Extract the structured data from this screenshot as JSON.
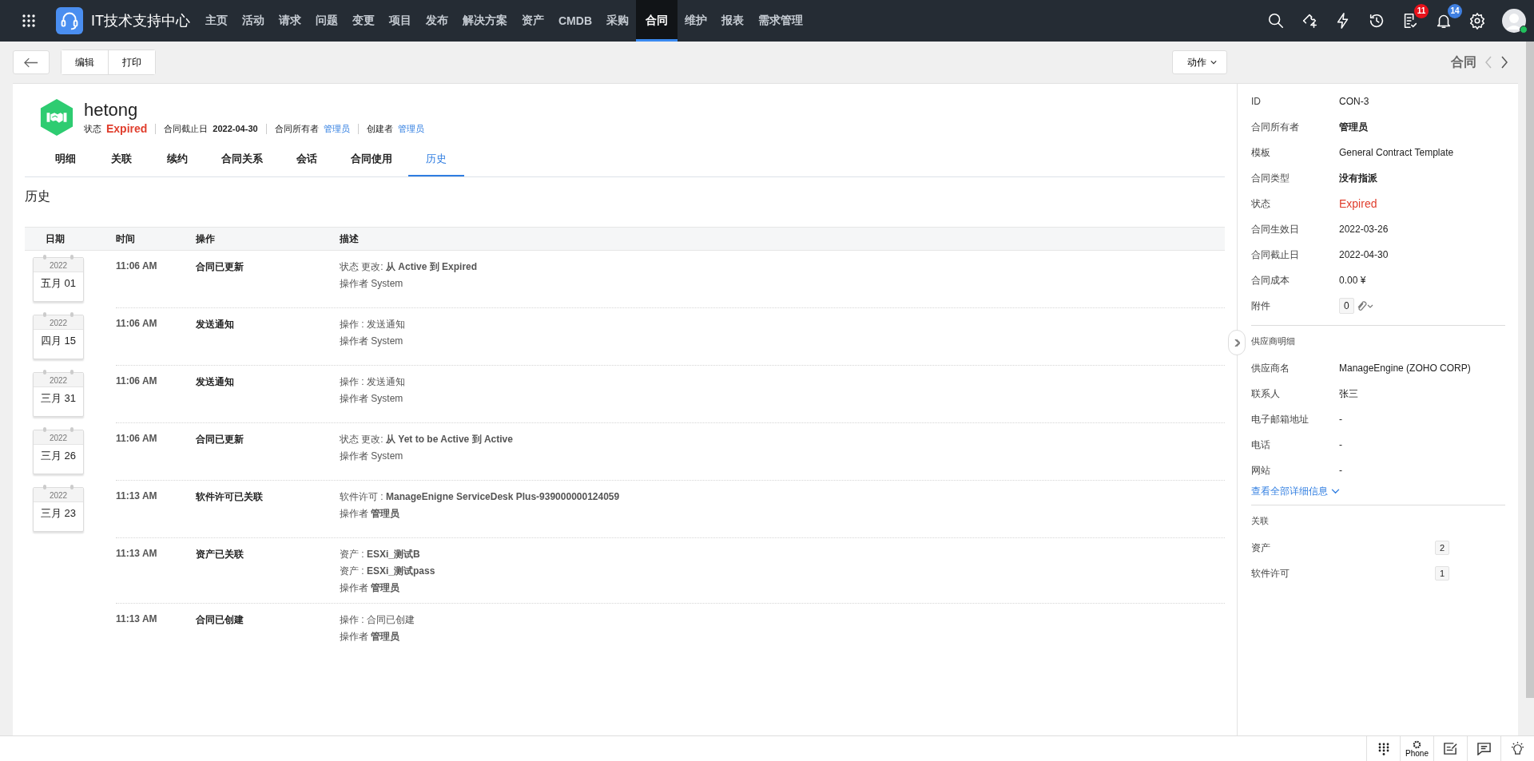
{
  "app": {
    "title": "IT技术支持中心"
  },
  "nav": [
    {
      "label": "主页",
      "selected": false
    },
    {
      "label": "活动",
      "selected": false
    },
    {
      "label": "请求",
      "selected": false
    },
    {
      "label": "问题",
      "selected": false
    },
    {
      "label": "变更",
      "selected": false
    },
    {
      "label": "项目",
      "selected": false
    },
    {
      "label": "发布",
      "selected": false
    },
    {
      "label": "解决方案",
      "selected": false
    },
    {
      "label": "资产",
      "selected": false
    },
    {
      "label": "CMDB",
      "selected": false
    },
    {
      "label": "采购",
      "selected": false
    },
    {
      "label": "合同",
      "selected": true
    },
    {
      "label": "维护",
      "selected": false
    },
    {
      "label": "报表",
      "selected": false
    },
    {
      "label": "需求管理",
      "selected": false
    }
  ],
  "top_icons": [
    {
      "kind": "search"
    },
    {
      "kind": "ticket"
    },
    {
      "kind": "bolt"
    },
    {
      "kind": "history"
    },
    {
      "kind": "tasks",
      "badge": "11",
      "color": "#e8121b"
    },
    {
      "kind": "bell",
      "badge": "14",
      "color": "#3f7fe0"
    },
    {
      "kind": "settings"
    },
    {
      "kind": "avatar"
    }
  ],
  "toolbar": {
    "buttons": [
      "编辑",
      "打印"
    ],
    "actions": "动作"
  },
  "record": {
    "name": "hetong",
    "meta": [
      {
        "label": "状态",
        "value": "Expired",
        "kind": "status"
      },
      {
        "label": "合同截止日",
        "value": "2022-04-30",
        "kind": "plain"
      },
      {
        "label": "合同所有者",
        "value": "管理员",
        "kind": "link"
      },
      {
        "label": "创建者",
        "value": "管理员",
        "kind": "link"
      }
    ]
  },
  "tabs": [
    {
      "label": "明细",
      "selected": false
    },
    {
      "label": "关联",
      "selected": false
    },
    {
      "label": "续约",
      "selected": false
    },
    {
      "label": "合同关系",
      "selected": false
    },
    {
      "label": "会话",
      "selected": false
    },
    {
      "label": "合同使用",
      "selected": false
    },
    {
      "label": "历史",
      "selected": true
    }
  ],
  "section_title": "历史",
  "history": {
    "columns": [
      "日期",
      "时间",
      "操作",
      "描述"
    ],
    "rows": [
      {
        "date": {
          "year": "2022",
          "day": "五月 01"
        },
        "time": "11:06 AM",
        "action": "合同已更新",
        "lines": [
          "状态 更改: **从 Active 到 Expired**",
          "操作者 System"
        ]
      },
      {
        "date": {
          "year": "2022",
          "day": "四月 15"
        },
        "time": "11:06 AM",
        "action": "发送通知",
        "lines": [
          "操作 : 发送通知",
          "操作者 System"
        ]
      },
      {
        "date": {
          "year": "2022",
          "day": "三月 31"
        },
        "time": "11:06 AM",
        "action": "发送通知",
        "lines": [
          "操作 : 发送通知",
          "操作者 System"
        ]
      },
      {
        "date": {
          "year": "2022",
          "day": "三月 26"
        },
        "time": "11:06 AM",
        "action": "合同已更新",
        "lines": [
          "状态 更改: **从 Yet to be Active 到 Active**",
          "操作者 System"
        ]
      },
      {
        "date": {
          "year": "2022",
          "day": "三月 23"
        },
        "time": "11:13 AM",
        "action": "软件许可已关联",
        "lines": [
          "软件许可 : **ManageEnigne ServiceDesk Plus-939000000124059**",
          "操作者 **管理员**"
        ]
      },
      {
        "time": "11:13 AM",
        "action": "资产已关联",
        "lines": [
          "资产 : **ESXi_测试B**",
          "资产 : **ESXi_测试pass**",
          "操作者 **管理员**"
        ]
      },
      {
        "time": "11:13 AM",
        "action": "合同已创建",
        "lines": [
          "操作 : 合同已创建",
          "操作者 **管理员**"
        ]
      }
    ]
  },
  "side": {
    "title": "合同",
    "fields": [
      {
        "label": "ID",
        "value": "CON-3",
        "kind": "plain"
      },
      {
        "label": "合同所有者",
        "value": "管理员",
        "kind": "strong"
      },
      {
        "label": "模板",
        "value": "General Contract Template",
        "kind": "plain"
      },
      {
        "label": "合同类型",
        "value": "没有指派",
        "kind": "strong"
      },
      {
        "label": "状态",
        "value": "Expired",
        "kind": "status"
      },
      {
        "label": "合同生效日",
        "value": "2022-03-26",
        "kind": "plain"
      },
      {
        "label": "合同截止日",
        "value": "2022-04-30",
        "kind": "plain"
      },
      {
        "label": "合同成本",
        "value": "0.00 ¥",
        "kind": "plain"
      },
      {
        "label": "附件",
        "value": "0",
        "kind": "attachment"
      }
    ],
    "vendor_title": "供应商明细",
    "vendor_fields": [
      {
        "label": "供应商名",
        "value": "ManageEngine (ZOHO CORP)"
      },
      {
        "label": "联系人",
        "value": "张三"
      },
      {
        "label": "电子邮箱地址",
        "value": "-"
      },
      {
        "label": "电话",
        "value": "-"
      },
      {
        "label": "网站",
        "value": "-"
      }
    ],
    "more_link": "查看全部详细信息",
    "related_title": "关联",
    "related": [
      {
        "label": "资产",
        "count": "2"
      },
      {
        "label": "软件许可",
        "count": "1"
      }
    ]
  },
  "footer": [
    {
      "kind": "dialpad"
    },
    {
      "kind": "phone",
      "label": "Phone"
    },
    {
      "kind": "note"
    },
    {
      "kind": "chat"
    },
    {
      "kind": "bulb"
    }
  ]
}
